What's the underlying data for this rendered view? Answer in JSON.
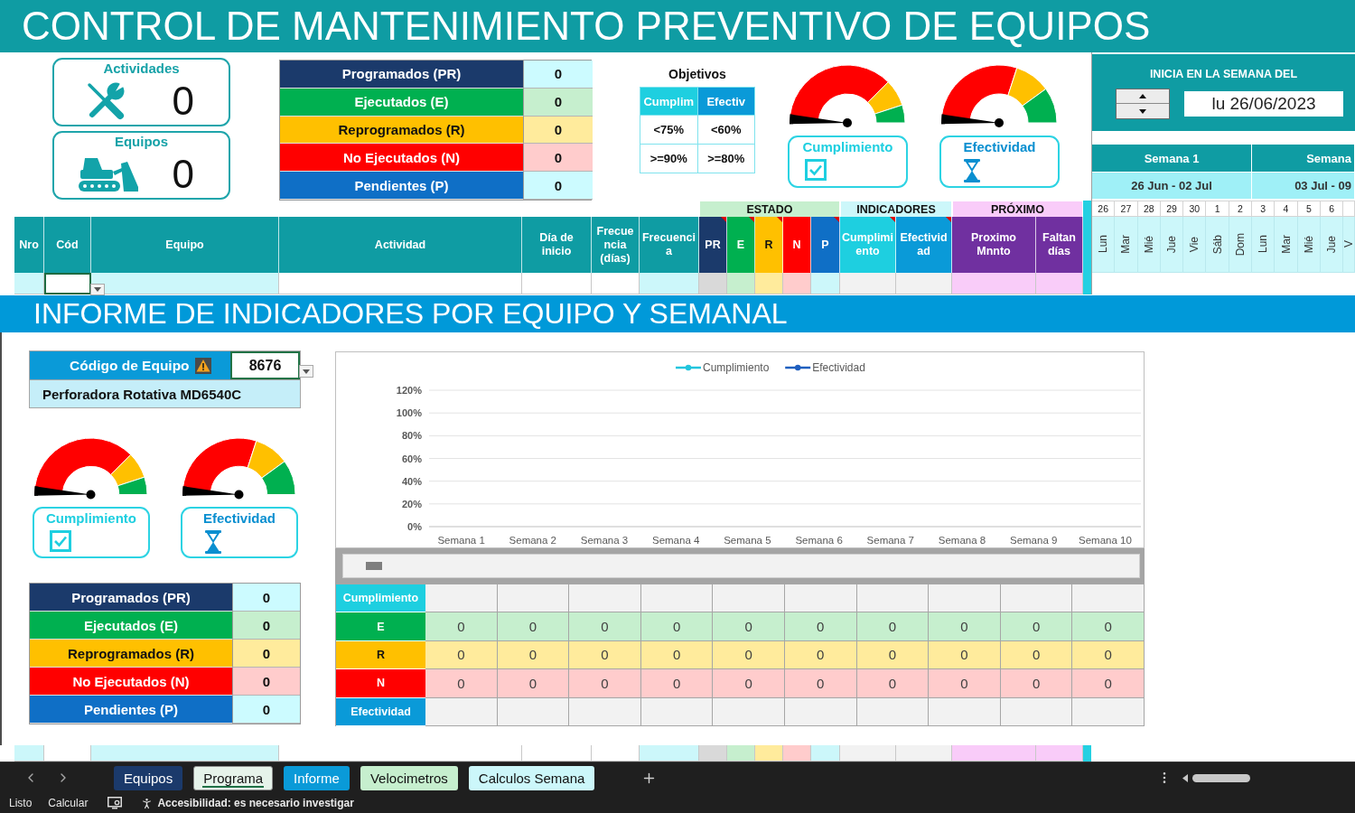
{
  "title": "CONTROL DE MANTENIMIENTO PREVENTIVO DE EQUIPOS",
  "counters": [
    {
      "kind": "tools",
      "label": "Actividades",
      "value": "0"
    },
    {
      "kind": "bulldozer",
      "label": "Equipos",
      "value": "0"
    }
  ],
  "summary": [
    {
      "label": "Programados (PR)",
      "value": "0",
      "color": "#1b3a6b"
    },
    {
      "label": "Ejecutados (E)",
      "value": "0",
      "color": "#00b050"
    },
    {
      "label": "Reprogramados (R)",
      "value": "0",
      "color": "#ffc000"
    },
    {
      "label": "No Ejecutados (N)",
      "value": "0",
      "color": "#ff0000"
    },
    {
      "label": "Pendientes (P)",
      "value": "0",
      "color": "#0f6fc6"
    }
  ],
  "objectives": {
    "title": "Objetivos",
    "columns": [
      {
        "label": "Cumplim",
        "color": "#1ecfe0"
      },
      {
        "label": "Efectiv",
        "color": "#0a9ad8"
      }
    ],
    "rows": [
      [
        "<75%",
        "<60%"
      ],
      [
        ">=90%",
        ">=80%"
      ]
    ]
  },
  "gauges": [
    {
      "kind": "compliance",
      "label": "Cumplimiento",
      "color": "#1ecfe0",
      "level": 0
    },
    {
      "kind": "effectiveness",
      "label": "Efectividad",
      "color": "#0a8fd0",
      "level": 0
    }
  ],
  "week_start": {
    "label": "INICIA EN LA SEMANA DEL",
    "value": "lu 26/06/2023"
  },
  "weeks": [
    {
      "label": "Semana 1",
      "range": "26 Jun - 02 Jul"
    },
    {
      "label": "Semana",
      "range": "03 Jul - 09"
    }
  ],
  "days": [
    {
      "number": "26",
      "name": "Lun"
    },
    {
      "number": "27",
      "name": "Mar"
    },
    {
      "number": "28",
      "name": "Mié"
    },
    {
      "number": "29",
      "name": "Jue"
    },
    {
      "number": "30",
      "name": "Vie"
    },
    {
      "number": "1",
      "name": "Sáb"
    },
    {
      "number": "2",
      "name": "Dom"
    },
    {
      "number": "3",
      "name": "Lun"
    },
    {
      "number": "4",
      "name": "Mar"
    },
    {
      "number": "5",
      "name": "Mié"
    },
    {
      "number": "6",
      "name": "Jue"
    },
    {
      "name": "V"
    }
  ],
  "table": {
    "columns": [
      {
        "label": "Nro",
        "kind": "formula",
        "color": "#0f9ca3",
        "comment": false,
        "selected": false
      },
      {
        "label": "Cód",
        "kind": "entry",
        "color": "#0f9ca3",
        "comment": false,
        "selected": true
      },
      {
        "label": "Equipo",
        "kind": "formula",
        "color": "#0f9ca3",
        "comment": false,
        "selected": false
      },
      {
        "label": "Actividad",
        "kind": "entry",
        "color": "#0f9ca3",
        "comment": false,
        "selected": false
      },
      {
        "label": "Día de inicio",
        "kind": "entry",
        "color": "#0f9ca3",
        "comment": false,
        "selected": false
      },
      {
        "label": "Frecuencia (días)",
        "kind": "entry",
        "color": "#0f9ca3",
        "comment": false,
        "selected": false
      },
      {
        "label": "Frecuencia",
        "kind": "formula",
        "color": "#0f9ca3",
        "comment": false,
        "selected": false
      }
    ],
    "column_groups": [
      {
        "label": "ESTADO",
        "color": "#c6efce",
        "columns": [
          {
            "label": "PR",
            "kind": "status",
            "color": "#1b3a6b",
            "comment": true,
            "selected": false
          },
          {
            "label": "E",
            "kind": "status",
            "color": "#00b050",
            "comment": true,
            "selected": false
          },
          {
            "label": "R",
            "kind": "status",
            "color": "#ffc000",
            "comment": true,
            "selected": false
          },
          {
            "label": "N",
            "kind": "status",
            "color": "#ff0000",
            "comment": false,
            "selected": false
          },
          {
            "label": "P",
            "kind": "status",
            "color": "#0f6fc6",
            "comment": true,
            "selected": false
          }
        ]
      },
      {
        "label": "INDICADORES",
        "color": "#ccf7fa",
        "columns": [
          {
            "label": "Cumplimiento",
            "kind": "indicator",
            "color": "#1ecfe0",
            "comment": true,
            "selected": false
          },
          {
            "label": "Efectividad",
            "kind": "indicator",
            "color": "#0a9ad8",
            "comment": true,
            "selected": false
          }
        ]
      },
      {
        "label": "PRÓXIMO",
        "color": "#f9ccf9",
        "columns": [
          {
            "label": "Proximo Mnnto",
            "kind": "schedule",
            "color": "#7030a0",
            "comment": false,
            "selected": false
          },
          {
            "label": "Faltan días",
            "kind": "schedule",
            "color": "#7030a0",
            "comment": false,
            "selected": false
          }
        ]
      }
    ]
  },
  "report": {
    "title": "INFORME DE INDICADORES POR EQUIPO Y SEMANAL",
    "equipment": {
      "label": "Código de Equipo",
      "code": "8676",
      "selected": true,
      "name": "Perforadora Rotativa MD6540C"
    },
    "gauges": [
      {
        "kind": "compliance",
        "label": "Cumplimiento",
        "color": "#1ecfe0",
        "level": 0
      },
      {
        "kind": "effectiveness",
        "label": "Efectividad",
        "color": "#0a8fd0",
        "level": 0
      }
    ],
    "summary": [
      {
        "label": "Programados (PR)",
        "value": "0",
        "color": "#1b3a6b"
      },
      {
        "label": "Ejecutados (E)",
        "value": "0",
        "color": "#00b050"
      },
      {
        "label": "Reprogramados (R)",
        "value": "0",
        "color": "#ffc000"
      },
      {
        "label": "No Ejecutados (N)",
        "value": "0",
        "color": "#ff0000"
      },
      {
        "label": "Pendientes (P)",
        "value": "0",
        "color": "#0f6fc6"
      }
    ],
    "chart_data": {
      "type": "line",
      "grid": true,
      "categories": [
        "Semana 1",
        "Semana 2",
        "Semana 3",
        "Semana 4",
        "Semana 5",
        "Semana 6",
        "Semana 7",
        "Semana 8",
        "Semana 9",
        "Semana 10"
      ],
      "series": [
        {
          "name": "Cumplimiento",
          "color": "#22c5dd",
          "values": [
            null,
            null,
            null,
            null,
            null,
            null,
            null,
            null,
            null,
            null
          ]
        },
        {
          "name": "Efectividad",
          "color": "#1f5fbf",
          "values": [
            null,
            null,
            null,
            null,
            null,
            null,
            null,
            null,
            null,
            null
          ]
        }
      ],
      "ylim": [
        0,
        1.2
      ],
      "yticks": [
        {
          "value": 0,
          "label": "0%"
        },
        {
          "value": 0.2,
          "label": "20%"
        },
        {
          "value": 0.4,
          "label": "40%"
        },
        {
          "value": 0.6,
          "label": "60%"
        },
        {
          "value": 0.8,
          "label": "80%"
        },
        {
          "value": 1,
          "label": "100%"
        },
        {
          "value": 1.2,
          "label": "120%"
        }
      ]
    },
    "weekly_table": [
      {
        "label": "Cumplimiento",
        "kind": "indicator",
        "color": "#1ecfe0"
      },
      {
        "label": "E",
        "kind": "count",
        "color": "#00b050",
        "values": [
          "0",
          "0",
          "0",
          "0",
          "0",
          "0",
          "0",
          "0",
          "0",
          "0"
        ]
      },
      {
        "label": "R",
        "kind": "count",
        "color": "#ffc000",
        "values": [
          "0",
          "0",
          "0",
          "0",
          "0",
          "0",
          "0",
          "0",
          "0",
          "0"
        ]
      },
      {
        "label": "N",
        "kind": "count",
        "color": "#ff0000",
        "values": [
          "0",
          "0",
          "0",
          "0",
          "0",
          "0",
          "0",
          "0",
          "0",
          "0"
        ]
      },
      {
        "label": "Efectividad",
        "kind": "indicator",
        "color": "#0a9ad8"
      }
    ]
  },
  "sheet_tabs": [
    {
      "label": "Equipos",
      "color": "#1b3a6b",
      "selected": false
    },
    {
      "label": "Programa",
      "color": "#e6f3ea",
      "selected": true
    },
    {
      "label": "Informe",
      "color": "#0a9ad8",
      "selected": false
    },
    {
      "label": "Velocimetros",
      "color": "#c6efce",
      "selected": false
    },
    {
      "label": "Calculos Semana",
      "color": "#ccf7fa",
      "selected": false
    }
  ],
  "status_bar": {
    "mode": "Listo",
    "calculate": "Calcular",
    "accessibility": "Accesibilidad: es necesario investigar"
  }
}
